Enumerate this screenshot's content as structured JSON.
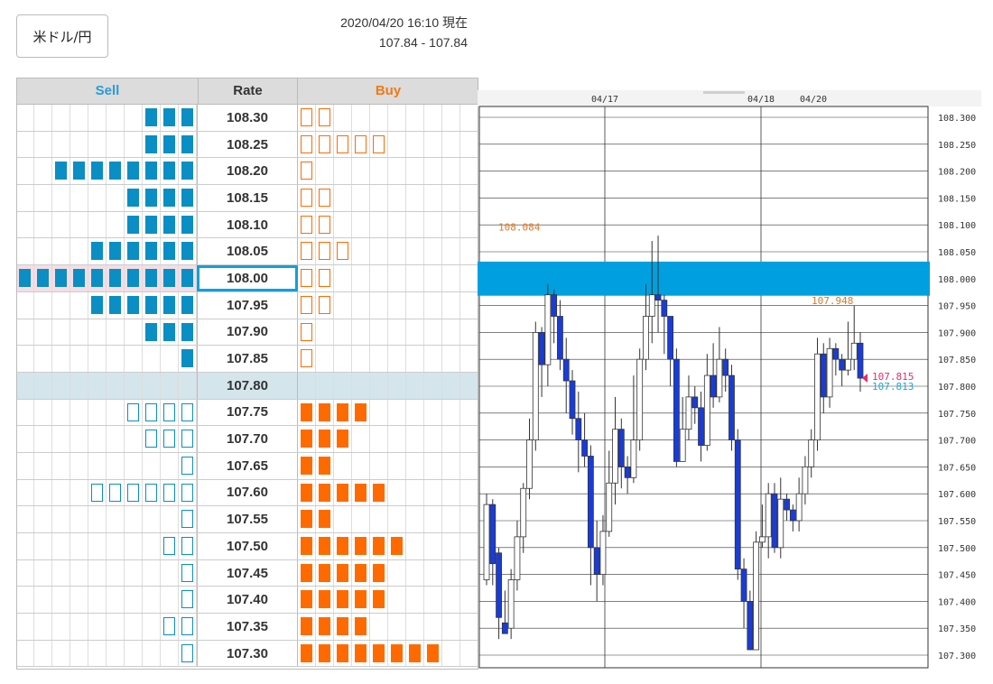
{
  "pair_label": "米ドル/円",
  "timestamp": "2020/04/20 16:10 現在",
  "quote": "107.84 - 107.84",
  "headers": {
    "sell": "Sell",
    "rate": "Rate",
    "buy": "Buy"
  },
  "colors": {
    "sell": "#0a8ec4",
    "buy": "#ff6a00",
    "sell_text": "#2a9bd6",
    "buy_text": "#f07a14",
    "band": "#00a0e0",
    "bull": "#ffffff",
    "bear": "#1a3cd6"
  },
  "current_rate": "107.80",
  "selected_rate": "108.00",
  "rows": [
    {
      "rate": "108.30",
      "sell": 3,
      "sell_style": "filled",
      "buy": 2,
      "buy_style": "outline"
    },
    {
      "rate": "108.25",
      "sell": 3,
      "sell_style": "filled",
      "buy": 5,
      "buy_style": "outline"
    },
    {
      "rate": "108.20",
      "sell": 8,
      "sell_style": "filled",
      "buy": 1,
      "buy_style": "outline"
    },
    {
      "rate": "108.15",
      "sell": 4,
      "sell_style": "filled",
      "buy": 2,
      "buy_style": "outline"
    },
    {
      "rate": "108.10",
      "sell": 4,
      "sell_style": "filled",
      "buy": 2,
      "buy_style": "outline"
    },
    {
      "rate": "108.05",
      "sell": 6,
      "sell_style": "filled",
      "buy": 3,
      "buy_style": "outline"
    },
    {
      "rate": "108.00",
      "sell": 10,
      "sell_style": "filled",
      "buy": 2,
      "buy_style": "outline"
    },
    {
      "rate": "107.95",
      "sell": 6,
      "sell_style": "filled",
      "buy": 2,
      "buy_style": "outline"
    },
    {
      "rate": "107.90",
      "sell": 3,
      "sell_style": "filled",
      "buy": 1,
      "buy_style": "outline"
    },
    {
      "rate": "107.85",
      "sell": 1,
      "sell_style": "filled",
      "buy": 1,
      "buy_style": "outline"
    },
    {
      "rate": "107.80",
      "sell": 0,
      "sell_style": "filled",
      "buy": 0,
      "buy_style": "filled"
    },
    {
      "rate": "107.75",
      "sell": 4,
      "sell_style": "outline",
      "buy": 4,
      "buy_style": "filled"
    },
    {
      "rate": "107.70",
      "sell": 3,
      "sell_style": "outline",
      "buy": 3,
      "buy_style": "filled"
    },
    {
      "rate": "107.65",
      "sell": 1,
      "sell_style": "outline",
      "buy": 2,
      "buy_style": "filled"
    },
    {
      "rate": "107.60",
      "sell": 6,
      "sell_style": "outline",
      "buy": 5,
      "buy_style": "filled"
    },
    {
      "rate": "107.55",
      "sell": 1,
      "sell_style": "outline",
      "buy": 2,
      "buy_style": "filled"
    },
    {
      "rate": "107.50",
      "sell": 2,
      "sell_style": "outline",
      "buy": 6,
      "buy_style": "filled"
    },
    {
      "rate": "107.45",
      "sell": 1,
      "sell_style": "outline",
      "buy": 5,
      "buy_style": "filled"
    },
    {
      "rate": "107.40",
      "sell": 1,
      "sell_style": "outline",
      "buy": 5,
      "buy_style": "filled"
    },
    {
      "rate": "107.35",
      "sell": 2,
      "sell_style": "outline",
      "buy": 4,
      "buy_style": "filled"
    },
    {
      "rate": "107.30",
      "sell": 1,
      "sell_style": "outline",
      "buy": 8,
      "buy_style": "filled"
    }
  ],
  "chart_data": {
    "type": "candlestick",
    "date_labels": [
      "04/17",
      "04/18",
      "04/20"
    ],
    "y_ticks": [
      "108.300",
      "108.250",
      "108.200",
      "108.150",
      "108.100",
      "108.050",
      "108.000",
      "107.950",
      "107.900",
      "107.850",
      "107.800",
      "107.750",
      "107.700",
      "107.650",
      "107.600",
      "107.550",
      "107.500",
      "107.450",
      "107.400",
      "107.350",
      "107.300"
    ],
    "ylim": [
      107.3,
      108.3
    ],
    "highlight_band": [
      107.975,
      108.025
    ],
    "annotations": {
      "high_left": "108.084",
      "high_right": "107.948"
    },
    "last_ask": "107.815",
    "last_bid": "107.813",
    "candles": [
      [
        107.44,
        107.58,
        107.6,
        107.43
      ],
      [
        107.58,
        107.47,
        107.59,
        107.43
      ],
      [
        107.49,
        107.37,
        107.5,
        107.33
      ],
      [
        107.36,
        107.34,
        107.42,
        107.35
      ],
      [
        107.35,
        107.44,
        107.46,
        107.33
      ],
      [
        107.44,
        107.52,
        107.55,
        107.42
      ],
      [
        107.52,
        107.61,
        107.62,
        107.49
      ],
      [
        107.61,
        107.7,
        107.74,
        107.59
      ],
      [
        107.7,
        107.9,
        107.92,
        107.68
      ],
      [
        107.9,
        107.84,
        107.91,
        107.78
      ],
      [
        107.84,
        107.97,
        107.99,
        107.8
      ],
      [
        107.97,
        107.93,
        107.98,
        107.88
      ],
      [
        107.93,
        107.85,
        107.96,
        107.83
      ],
      [
        107.85,
        107.81,
        107.89,
        107.75
      ],
      [
        107.81,
        107.74,
        107.83,
        107.71
      ],
      [
        107.74,
        107.7,
        107.79,
        107.64
      ],
      [
        107.7,
        107.67,
        107.75,
        107.65
      ],
      [
        107.67,
        107.5,
        107.69,
        107.43
      ],
      [
        107.5,
        107.45,
        107.55,
        107.4
      ],
      [
        107.45,
        107.53,
        107.56,
        107.43
      ],
      [
        107.53,
        107.62,
        107.68,
        107.52
      ],
      [
        107.62,
        107.72,
        107.78,
        107.58
      ],
      [
        107.72,
        107.65,
        107.74,
        107.61
      ],
      [
        107.65,
        107.63,
        107.67,
        107.6
      ],
      [
        107.63,
        107.7,
        107.82,
        107.62
      ],
      [
        107.7,
        107.85,
        107.87,
        107.68
      ],
      [
        107.85,
        107.93,
        107.99,
        107.83
      ],
      [
        107.93,
        107.97,
        108.07,
        107.88
      ],
      [
        107.97,
        107.96,
        108.08,
        107.9
      ],
      [
        107.96,
        107.93,
        107.97,
        107.86
      ],
      [
        107.93,
        107.85,
        107.89,
        107.8
      ],
      [
        107.85,
        107.66,
        107.87,
        107.65
      ],
      [
        107.66,
        107.72,
        107.78,
        107.67
      ],
      [
        107.72,
        107.78,
        107.82,
        107.7
      ],
      [
        107.78,
        107.76,
        107.8,
        107.73
      ],
      [
        107.76,
        107.69,
        107.79,
        107.66
      ],
      [
        107.69,
        107.82,
        107.86,
        107.68
      ],
      [
        107.82,
        107.78,
        107.88,
        107.76
      ],
      [
        107.78,
        107.85,
        107.91,
        107.77
      ],
      [
        107.85,
        107.82,
        107.87,
        107.79
      ],
      [
        107.82,
        107.7,
        107.84,
        107.68
      ],
      [
        107.7,
        107.46,
        107.72,
        107.44
      ],
      [
        107.46,
        107.4,
        107.48,
        107.35
      ],
      [
        107.4,
        107.31,
        107.42,
        107.31
      ],
      [
        107.31,
        107.51,
        107.53,
        107.31
      ],
      [
        107.51,
        107.52,
        107.58,
        107.5
      ],
      [
        107.52,
        107.6,
        107.62,
        107.48
      ],
      [
        107.6,
        107.5,
        107.62,
        107.49
      ],
      [
        107.5,
        107.59,
        107.63,
        107.48
      ],
      [
        107.59,
        107.57,
        107.6,
        107.55
      ],
      [
        107.57,
        107.55,
        107.58,
        107.53
      ],
      [
        107.55,
        107.6,
        107.63,
        107.53
      ],
      [
        107.6,
        107.65,
        107.67,
        107.58
      ],
      [
        107.65,
        107.7,
        107.72,
        107.63
      ],
      [
        107.7,
        107.86,
        107.89,
        107.68
      ],
      [
        107.86,
        107.78,
        107.88,
        107.75
      ],
      [
        107.78,
        107.87,
        107.89,
        107.76
      ],
      [
        107.87,
        107.85,
        107.88,
        107.82
      ],
      [
        107.85,
        107.83,
        107.86,
        107.8
      ],
      [
        107.83,
        107.85,
        107.92,
        107.82
      ],
      [
        107.85,
        107.88,
        107.95,
        107.83
      ],
      [
        107.88,
        107.815,
        107.9,
        107.79
      ]
    ]
  }
}
